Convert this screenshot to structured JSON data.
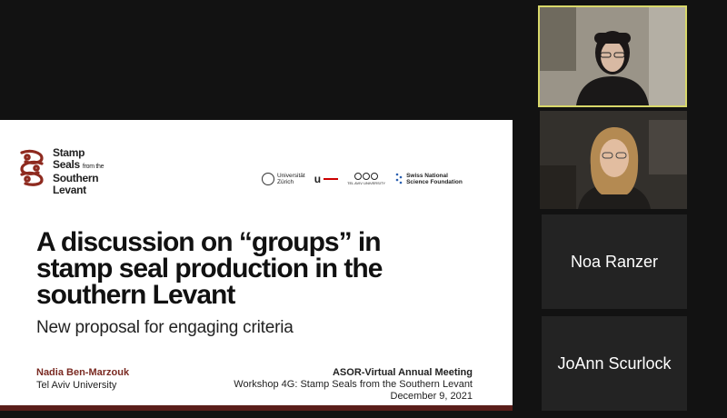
{
  "slide": {
    "logo": {
      "line1": "Stamp",
      "line2": "Seals",
      "line2_small": "from the",
      "line3": "Southern",
      "line4": "Levant"
    },
    "partners": {
      "uzh_line1": "Universität",
      "uzh_line2": "Zürich",
      "unibern": "u",
      "tau_text": "TEL AVIV UNIVERSITY",
      "snsf_line1": "Swiss National",
      "snsf_line2": "Science Foundation"
    },
    "title_lines": [
      "A discussion on “groups” in",
      "stamp seal production in the",
      "southern Levant"
    ],
    "subtitle": "New proposal for engaging criteria",
    "presenter_name": "Nadia Ben-Marzouk",
    "presenter_affiliation": "Tel Aviv University",
    "event_title": "ASOR-Virtual Annual Meeting",
    "event_workshop": "Workshop 4G: Stamp Seals from the Southern Levant",
    "event_date": "December 9, 2021"
  },
  "participants": [
    {
      "name": "Noa Ranzer"
    },
    {
      "name": "JoAnn Scurlock"
    }
  ],
  "colors": {
    "background": "#121212",
    "active_speaker_border": "#d8d86a",
    "slide_accent": "#5a1e1a",
    "presenter_name": "#7a2a22",
    "name_tile": "#232323"
  }
}
